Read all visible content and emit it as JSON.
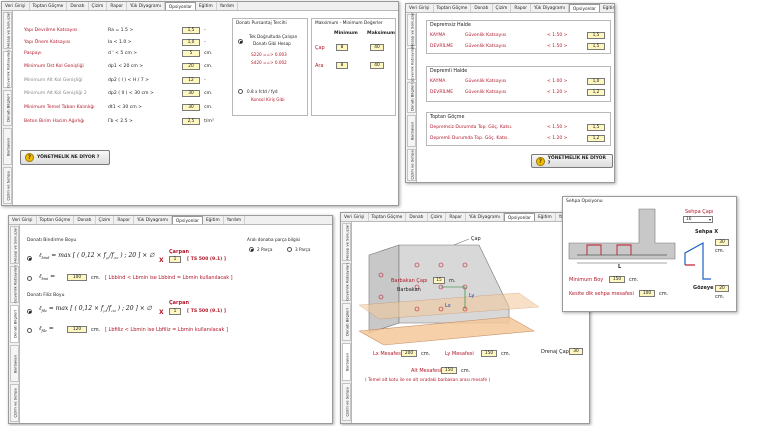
{
  "tabs_a": [
    "Veri Girişi",
    "Toptan Göçme",
    "Donatı",
    "Çizim",
    "Rapor",
    "Yük Diyagramı",
    "Opsiyonlar",
    "Eğitim",
    "Yardım"
  ],
  "tabs_b": [
    "Veri Girişi",
    "Toptan Göçme",
    "Donatı",
    "Çizim",
    "Rapor",
    "Yük Diyagramı",
    "Opsiyonlar",
    "Eğitim",
    "Yardım"
  ],
  "vtabs": [
    "Hesap ve Sonuçlar",
    "Güvenlik Katsayıları",
    "Donatı Bilgileri",
    "Barbakan",
    "Çizim ve Sehpa"
  ],
  "w1": {
    "rows": [
      {
        "label": "Yapı Devrilme Katsayısı",
        "expr": "Ra  =  1.5  >",
        "value": "1,5",
        "unit": "-"
      },
      {
        "label": "Yapı Önem Katsayısı",
        "expr": "Ia  <  1.0  >",
        "value": "1,0",
        "unit": "-"
      },
      {
        "label": "Paspayı",
        "expr": "d '  <  5 cm  >",
        "value": "5",
        "unit": "cm."
      },
      {
        "label": "Minimum Üst Kol Genişliği",
        "expr": "dp1  <  20 cm  >",
        "value": "20",
        "unit": "cm."
      },
      {
        "label": "Minimum Alt Kol Genişliği",
        "expr": "dp2 ( I )  <  H / 7  >",
        "value": "12",
        "unit": "-"
      },
      {
        "label": "Minimum Alt Kol Genişliği 2",
        "expr": "dp2 ( II )  <  30 cm  >",
        "value": "30",
        "unit": "cm."
      },
      {
        "label": "Minimum Temel Taban Kalınlığı",
        "expr": "dt1  <  30 cm  >",
        "value": "30",
        "unit": "cm."
      },
      {
        "label": "Beton Birim Hacim Ağırlığı",
        "expr": "Γb  <  2.5  >",
        "value": "2,5",
        "unit": "t/m³"
      }
    ],
    "donati_title": "Donatı Pursantaj Tercihi",
    "radio1_line1": "Tek Doğrultuda Çalışan",
    "radio1_line2": "Donatı Gibi Hesap",
    "s220": "S220  ==>  0.003",
    "s420": "S420  ==>  0.002",
    "radio2_line1": "0.8 x fctd / fyd",
    "radio2_line2": "Konsol Kiriş Gibi",
    "maxmin_title": "Maksimum - Minimum Değerler",
    "col_min": "Minimum",
    "col_max": "Maksimum",
    "cap_label": "Çap",
    "cap_min": "8",
    "cap_max": "40",
    "ara_label": "Ara",
    "ara_min": "8",
    "ara_max": "40",
    "button": "YÖNETMELİK NE DİYOR ?"
  },
  "w2": {
    "sec1_title": "Depremsiz Halde",
    "sec1_rows": [
      {
        "l1": "KAYMA",
        "l2": "Güvenlik Katsayısı",
        "cmp": "<  1.50  >",
        "value": "1,5"
      },
      {
        "l1": "DEVRİLME",
        "l2": "Güvenlik Katsayısı",
        "cmp": "<  1.50  >",
        "value": "1,5"
      }
    ],
    "sec2_title": "Depremli Halde",
    "sec2_rows": [
      {
        "l1": "KAYMA",
        "l2": "Güvenlik Katsayısı",
        "cmp": "<  1.00  >",
        "value": "1,0"
      },
      {
        "l1": "DEVRİLME",
        "l2": "Güvenlik Katsayısı",
        "cmp": "<  1.20  >",
        "value": "1,2"
      }
    ],
    "sec3_title": "Toptan Göçme",
    "sec3_rows": [
      {
        "l1": "Depremsiz Durumda Top. Göç. Katsı.",
        "cmp": "<  1.50  >",
        "value": "1,5"
      },
      {
        "l1": "Depremli Durumda Top. Göç. Katsı.",
        "cmp": "<  1.20  >",
        "value": "1,2"
      }
    ],
    "button": "YÖNETMELİK NE DİYOR ?"
  },
  "w3": {
    "title1": "Donatı Bindirme Boyu",
    "lhs1": "ℓ",
    "sub1": "bind",
    "carpan_label": "Çarpan",
    "carpan1": "1",
    "ts1": "[  TS 500     (9.1) ]",
    "min1_label": "ℓ",
    "min1_sub": "bmi",
    "min1_value": "100",
    "min1_unit": "cm.",
    "min1_note": "[ Lbbind < Lbmin ise Lbbind = Lbmin kullanılacak ]",
    "title2": "Donatı Filiz Boyu",
    "lhs2": "ℓ",
    "sub2": "filz",
    "carpan2": "1",
    "ts2": "[  TS 500     (9.1) ]",
    "min2_value": "120",
    "min2_unit": "cm.",
    "min2_note": "[ Lbfiliz < Lbmin ise Lbfiliz = Lbmin kullanılacak ]",
    "parca_title": "Aralı donatıa parça bilgisi",
    "parca_opt1": "2 Parça",
    "parca_opt2": "3 Parça"
  },
  "w4": {
    "cap": "Çap",
    "barbakan_cap_label": "Barbakan Çapı",
    "barbakan_cap_value": "15",
    "barbakan_cap_unit": "m.",
    "barbakan": "Barbakan",
    "lx": "Lx",
    "ly": "Ly",
    "lx_mesafe_label": "Lx Mesafesi",
    "lx_mesafe_value": "200",
    "ly_mesafe_label": "Ly Mesafesi",
    "ly_mesafe_value": "150",
    "unit": "cm.",
    "alt_mesafe_label": "Alt Mesafesi",
    "alt_mesafe_value": "150",
    "note": "( Temel alt kotu ile en alt sıradaki barbakan arası mesafe )",
    "drenaj_label": "Drenaj Çapı",
    "drenaj_value": "30"
  },
  "w5": {
    "title": "Sehpa Opsiyonu",
    "cap_label": "Sehpa Çapı",
    "cap_value": "16",
    "sehpa_x": "Sehpa X",
    "sehpa_x_value": "30",
    "l_label": "L",
    "min_boy_label": "Minimum Boy",
    "min_boy_value": "150",
    "kesite_label": "Kesite dik sehpa mesafesi",
    "kesite_value": "100",
    "gozeye": "Gözeye",
    "gozeye_value": "20",
    "unit": "cm."
  }
}
